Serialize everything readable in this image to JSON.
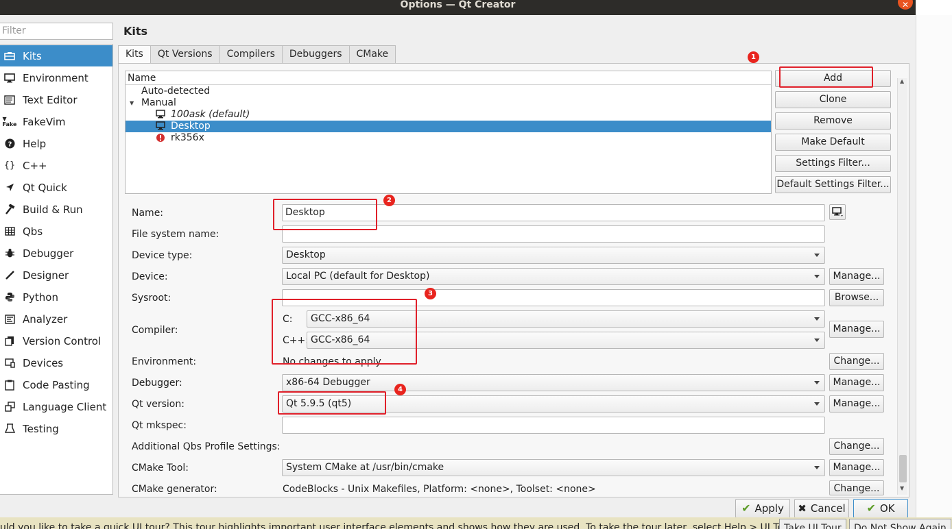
{
  "window": {
    "title": "Options — Qt Creator"
  },
  "sidebar": {
    "filter_placeholder": "Filter",
    "items": [
      {
        "label": "Kits",
        "icon": "kits-icon",
        "selected": true
      },
      {
        "label": "Environment",
        "icon": "monitor-icon"
      },
      {
        "label": "Text Editor",
        "icon": "text-editor-icon"
      },
      {
        "label": "FakeVim",
        "icon": "fakevim-icon"
      },
      {
        "label": "Help",
        "icon": "help-icon"
      },
      {
        "label": "C++",
        "icon": "braces-icon"
      },
      {
        "label": "Qt Quick",
        "icon": "qt-quick-icon"
      },
      {
        "label": "Build & Run",
        "icon": "hammer-icon"
      },
      {
        "label": "Qbs",
        "icon": "qbs-icon"
      },
      {
        "label": "Debugger",
        "icon": "bug-icon"
      },
      {
        "label": "Designer",
        "icon": "pen-icon"
      },
      {
        "label": "Python",
        "icon": "python-icon"
      },
      {
        "label": "Analyzer",
        "icon": "analyzer-icon"
      },
      {
        "label": "Version Control",
        "icon": "version-control-icon"
      },
      {
        "label": "Devices",
        "icon": "devices-icon"
      },
      {
        "label": "Code Pasting",
        "icon": "clipboard-icon"
      },
      {
        "label": "Language Client",
        "icon": "language-client-icon"
      },
      {
        "label": "Testing",
        "icon": "testing-icon"
      }
    ]
  },
  "page": {
    "title": "Kits",
    "tabs": [
      "Kits",
      "Qt Versions",
      "Compilers",
      "Debuggers",
      "CMake"
    ]
  },
  "kit_tree": {
    "header": "Name",
    "rows": [
      {
        "label": "Auto-detected",
        "level": 0
      },
      {
        "label": "Manual",
        "level": 0,
        "expanded": true
      },
      {
        "label": "100ask (default)",
        "level": 1,
        "icon": "monitor-icon",
        "italic": true
      },
      {
        "label": "Desktop",
        "level": 1,
        "icon": "monitor-icon",
        "selected": true
      },
      {
        "label": "rk356x",
        "level": 1,
        "icon": "error-icon"
      }
    ]
  },
  "kit_buttons": {
    "add": "Add",
    "clone": "Clone",
    "remove": "Remove",
    "make_default": "Make Default",
    "settings_filter": "Settings Filter...",
    "default_settings_filter": "Default Settings Filter..."
  },
  "form": {
    "name_label": "Name:",
    "name_value": "Desktop",
    "fs_name_label": "File system name:",
    "fs_name_value": "",
    "device_type_label": "Device type:",
    "device_type_value": "Desktop",
    "device_label": "Device:",
    "device_value": "Local PC (default for Desktop)",
    "sysroot_label": "Sysroot:",
    "sysroot_value": "",
    "compiler_label": "Compiler:",
    "compiler_c_label": "C:",
    "compiler_c_value": "GCC-x86_64",
    "compiler_cpp_label": "C++:",
    "compiler_cpp_value": "GCC-x86_64",
    "environment_label": "Environment:",
    "environment_value": "No changes to apply.",
    "debugger_label": "Debugger:",
    "debugger_value": "x86-64 Debugger",
    "qt_version_label": "Qt version:",
    "qt_version_value": "Qt 5.9.5 (qt5)",
    "qt_mkspec_label": "Qt mkspec:",
    "qt_mkspec_value": "",
    "qbs_label": "Additional Qbs Profile Settings:",
    "cmake_tool_label": "CMake Tool:",
    "cmake_tool_value": "System CMake at /usr/bin/cmake",
    "cmake_gen_label": "CMake generator:",
    "cmake_gen_value": "CodeBlocks - Unix Makefiles, Platform: <none>, Toolset: <none>",
    "manage": "Manage...",
    "browse": "Browse...",
    "change": "Change..."
  },
  "annotations": [
    "1",
    "2",
    "3",
    "4"
  ],
  "footer": {
    "apply": "Apply",
    "cancel": "Cancel",
    "ok": "OK"
  },
  "tour": {
    "text": "uld you like to take a quick UI tour? This tour highlights important user interface elements and shows how they are used. To take the tour later, select Help > UI Tour.",
    "take": "Take UI Tour",
    "dont_show": "Do Not Show Again"
  },
  "colors": {
    "selection": "#3c8dc9",
    "annotation": "#e0202a",
    "titlebar": "#2d2c29",
    "close": "#e95420"
  }
}
